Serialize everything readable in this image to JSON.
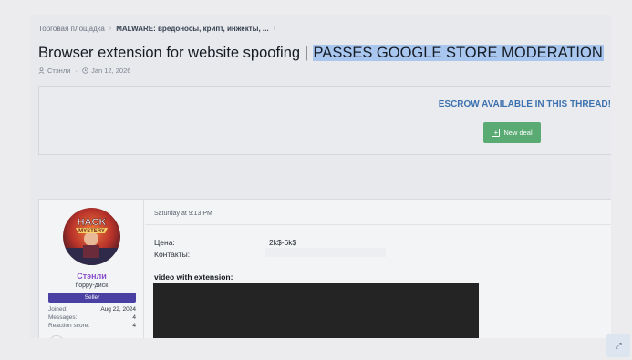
{
  "breadcrumb": {
    "items": [
      "Торговая площадка",
      "MALWARE: вредоносы, крипт, инжекты, ..."
    ]
  },
  "thread": {
    "title_prefix": "Browser extension for website spoofing | ",
    "title_highlight": "PASSES GOOGLE STORE MODERATION",
    "author": "Стэнли",
    "meta_separator": " · ",
    "date": "Jan 12, 2026"
  },
  "escrow": {
    "text": "ESCROW AVAILABLE IN THIS THREAD!",
    "button_label": "New deal"
  },
  "post": {
    "date": "Saturday at 9:13 PM",
    "user": {
      "name": "Стэнли",
      "title": "floppy-диск",
      "badge": "Seller",
      "stats": [
        {
          "label": "Joined:",
          "value": "Aug 22, 2024"
        },
        {
          "label": "Messages:",
          "value": "4"
        },
        {
          "label": "Reaction score:",
          "value": "4"
        }
      ]
    },
    "fields": [
      {
        "label": "Цена:",
        "value": "2k$-6k$"
      },
      {
        "label": "Контакты:",
        "value": ""
      }
    ],
    "video_label": "video with extension:"
  },
  "colors": {
    "accent_blue": "#3c72b0",
    "deal_green": "#5aab73",
    "username_purple": "#8a4fc9",
    "badge_indigo": "#4a3fa3",
    "highlight": "#a9c6ee"
  },
  "icons": [
    "user-icon",
    "clock-icon",
    "plus-square-icon",
    "chevron-right-icon",
    "expand-icon"
  ]
}
